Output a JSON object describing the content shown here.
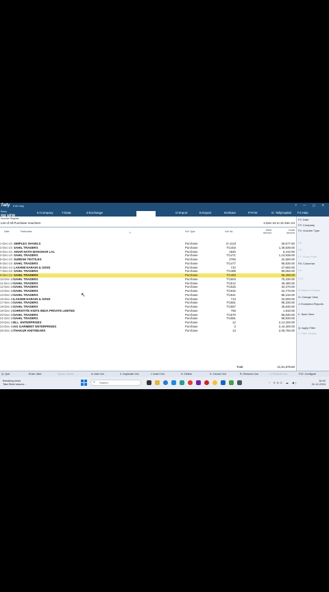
{
  "app": {
    "logo": "Tally",
    "menu_line": "Edit   Help",
    "edition": "Prime",
    "edition_name": "SILVER",
    "window_controls": "? — ▢ ✕"
  },
  "top_menu": [
    {
      "label": "K:Company"
    },
    {
      "label": "Y:Data"
    },
    {
      "label": "Z:Exchange"
    },
    {
      "label": "O:Import"
    },
    {
      "label": "E:Export"
    },
    {
      "label": "M:Share"
    },
    {
      "label": "P:Print"
    },
    {
      "label": "F1:Help"
    },
    {
      "label": "G: TallyCapital"
    }
  ],
  "report": {
    "name": "Voucher Register",
    "subtitle": "List of All Purchase Vouchers",
    "period": "1-Dec-24 to 31-Dec-24"
  },
  "columns": {
    "date": "Date",
    "particulars": "Particulars",
    "vch_type": "Vch Type",
    "vch_no": "Vch No.",
    "debit": "Debit Amount",
    "credit": "Credit Amount"
  },
  "rows": [
    {
      "date": "1-Dec-24",
      "party": "SIMPLEX SHAWLS",
      "type": "Purchase",
      "no": "G-1123",
      "amount": "25,677.50"
    },
    {
      "date": "2-Dec-24",
      "party": "SAHIL TRADERS",
      "type": "Purchase",
      "no": "T/1403",
      "amount": "1,30,839.00"
    },
    {
      "date": "3-Dec-24",
      "party": "AMAR NATH MANOHAR LAL",
      "type": "Purchase",
      "no": "1845",
      "amount": "5,410.00"
    },
    {
      "date": "4-Dec-24",
      "party": "SAHIL TRADERS",
      "type": "Purchase",
      "no": "T/1471",
      "amount": "1,10,838.00"
    },
    {
      "date": "5-Dec-24",
      "party": "SURESH TEXTILES",
      "type": "Purchase",
      "no": "2765",
      "amount": "22,590.00"
    },
    {
      "date": "6-Dec-24",
      "party": "SAHIL TRADERS",
      "type": "Purchase",
      "no": "T/1477",
      "amount": "95,830.00"
    },
    {
      "date": "6-Dec-24",
      "party": "LAKHMI NARAIN & SONS",
      "type": "Purchase",
      "no": "710",
      "amount": "27,900.00"
    },
    {
      "date": "7-Dec-24",
      "party": "SAHIL TRADERS",
      "type": "Purchase",
      "no": "T/1489",
      "amount": "95,050.00"
    },
    {
      "date": "9-Dec-24",
      "party": "SAHIL TRADERS",
      "type": "Purchase",
      "no": "T/1493",
      "amount": "55,498.00"
    },
    {
      "date": "10-Dec-24",
      "party": "SAHIL TRADERS",
      "type": "Purchase",
      "no": "T/1504",
      "amount": "75,330.00"
    },
    {
      "date": "11-Dec-24",
      "party": "SAHIL TRADERS",
      "type": "Purchase",
      "no": "T/1512",
      "amount": "49,480.00"
    },
    {
      "date": "12-Dec-24",
      "party": "SAHIL TRADERS",
      "type": "Purchase",
      "no": "T/1525",
      "amount": "32,370.00"
    },
    {
      "date": "13-Dec-24",
      "party": "SAHIL TRADERS",
      "type": "Purchase",
      "no": "T/1532",
      "amount": "22,770.00"
    },
    {
      "date": "14-Dec-24",
      "party": "SAHIL TRADERS",
      "type": "Purchase",
      "no": "T/1541",
      "amount": "85,410.00"
    },
    {
      "date": "16-Dec-24",
      "party": "LAKHMI NARAIN & SONS",
      "type": "Purchase",
      "no": "713",
      "amount": "32,600.00"
    },
    {
      "date": "17-Dec-24",
      "party": "SAHIL TRADERS",
      "type": "Purchase",
      "no": "T/1551",
      "amount": "95,330.00"
    },
    {
      "date": "18-Dec-24",
      "party": "SAHIL TRADERS",
      "type": "Purchase",
      "no": "T/1557",
      "amount": "45,830.00"
    },
    {
      "date": "19-Dec-24",
      "party": "CHRISTITE KNITS INDIA PRIVATE LIMITED",
      "type": "Purchase",
      "no": "759",
      "amount": "1,910.00"
    },
    {
      "date": "20-Dec-24",
      "party": "SAHIL TRADERS",
      "type": "Purchase",
      "no": "T/1570",
      "amount": "85,830.00"
    },
    {
      "date": "21-Dec-24",
      "party": "SAHIL TRADERS",
      "type": "Purchase",
      "no": "T/1581",
      "amount": "98,830.00"
    },
    {
      "date": "23-Dec-24",
      "party": "B.L. ENTERPRISES",
      "type": "Purchase",
      "no": "12",
      "amount": "2,14,200.00"
    },
    {
      "date": "24-Dec-24",
      "party": "AG GARMENT ENTERPRISES",
      "type": "Purchase",
      "no": "3",
      "amount": "2,44,400.00"
    },
    {
      "date": "26-Dec-24",
      "party": "THAKUR KNITWEARS",
      "type": "Purchase",
      "no": "13",
      "amount": "2,06,750.00"
    }
  ],
  "highlighted_row_index": 8,
  "total": {
    "label": "Total:",
    "value": "21,51,678.50"
  },
  "right_panel": [
    {
      "label": "F2: Date",
      "dim": false
    },
    {
      "label": "F3: Company",
      "dim": false
    },
    {
      "label": "F4: Voucher Type",
      "dim": false
    },
    {
      "label": "F5:",
      "dim": true
    },
    {
      "label": "F6:",
      "dim": true
    },
    {
      "label": "F7: Show Profit",
      "dim": true
    },
    {
      "label": "F8: Columnar",
      "dim": false
    },
    {
      "label": "F9:",
      "dim": true
    },
    {
      "label": "F10:",
      "dim": true
    },
    {
      "label": "B: Basis of Values",
      "dim": true
    },
    {
      "label": "H: Change View",
      "dim": false
    },
    {
      "label": "J: Exception Reports",
      "dim": false
    },
    {
      "label": "L: Save View",
      "dim": false
    },
    {
      "label": "Q: Apply Filter",
      "dim": false
    },
    {
      "label": "F: Filter Details",
      "dim": true
    }
  ],
  "bottom_bar": [
    {
      "label": "Q: Quit",
      "dim": false
    },
    {
      "label": "Enter: Alter",
      "dim": false
    },
    {
      "label": "Space: Select",
      "dim": true
    },
    {
      "label": "A: Add Vch",
      "dim": false
    },
    {
      "label": "2: Duplicate Vch",
      "dim": false
    },
    {
      "label": "I: Insert Vch",
      "dim": false
    },
    {
      "label": "D: Delete",
      "dim": false
    },
    {
      "label": "X: Cancel Vch",
      "dim": false
    },
    {
      "label": "R: Remove Line",
      "dim": false
    },
    {
      "label": "U: Restore Line",
      "dim": true
    },
    {
      "label": "F12: Configure",
      "dim": false
    }
  ],
  "taskbar": {
    "weather_title": "Breaking news",
    "weather_sub": "Tata Steel shares...",
    "search_placeholder": "Search",
    "clock_time": "16:42",
    "clock_date": "31-12-2024",
    "tray": "^ ENG ☁ ◀)"
  },
  "colors": {
    "titlebar": "#1f4e79",
    "highlight": "#f3e66a",
    "panel": "#eef2f8"
  }
}
